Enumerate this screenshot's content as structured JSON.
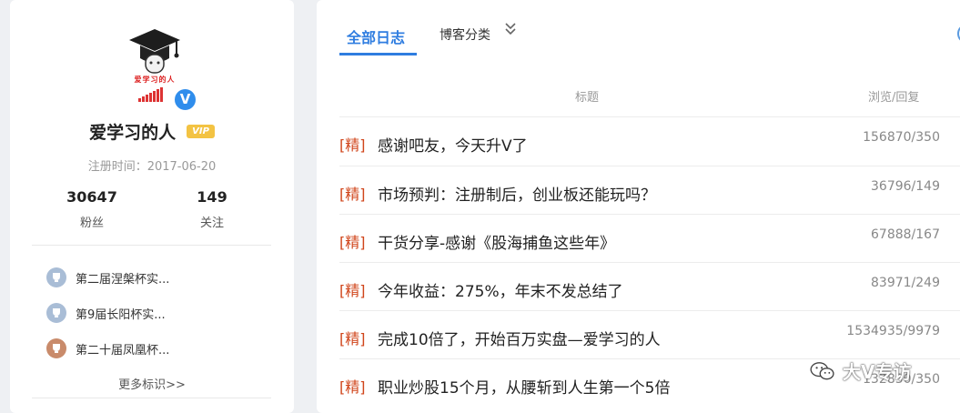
{
  "profile": {
    "avatar_caption": "爱学习的人",
    "verify_symbol": "V",
    "username": "爱学习的人",
    "vip_label": "VIP",
    "register_label": "注册时间：2017-06-20",
    "stats": [
      {
        "value": "30647",
        "label": "粉丝"
      },
      {
        "value": "149",
        "label": "关注"
      }
    ],
    "badges": [
      {
        "label": "第二届涅槃杯实...",
        "color": "#a9bdd6"
      },
      {
        "label": "第9届长阳杯实...",
        "color": "#a9bdd6"
      },
      {
        "label": "第二十届凤凰杯...",
        "color": "#c98b6b"
      }
    ],
    "more_badges": "更多标识>>"
  },
  "tabs": {
    "all_logs": "全部日志",
    "blog_category": "博客分类"
  },
  "table": {
    "headers": {
      "title": "标题",
      "stats": "浏览/回复"
    },
    "rows": [
      {
        "tag": "[精]",
        "title": "感谢吧友，今天升V了",
        "stat": "156870/350"
      },
      {
        "tag": "[精]",
        "title": "市场预判：注册制后，创业板还能玩吗？",
        "stat": "36796/149"
      },
      {
        "tag": "[精]",
        "title": "干货分享-感谢《股海捕鱼这些年》",
        "stat": "67888/167"
      },
      {
        "tag": "[精]",
        "title": "今年收益：275%，年末不发总结了",
        "stat": "83971/249"
      },
      {
        "tag": "[精]",
        "title": "完成10倍了，开始百万实盘—爱学习的人",
        "stat": "1534935/9979"
      },
      {
        "tag": "[精]",
        "title": "职业炒股15个月，从腰斩到人生第一个5倍",
        "stat": "132830/350"
      }
    ]
  },
  "watermark": {
    "text": "大V专访"
  },
  "colors": {
    "accent": "#2f7de0",
    "tag": "#d0451b",
    "vip": "#f3c343"
  }
}
